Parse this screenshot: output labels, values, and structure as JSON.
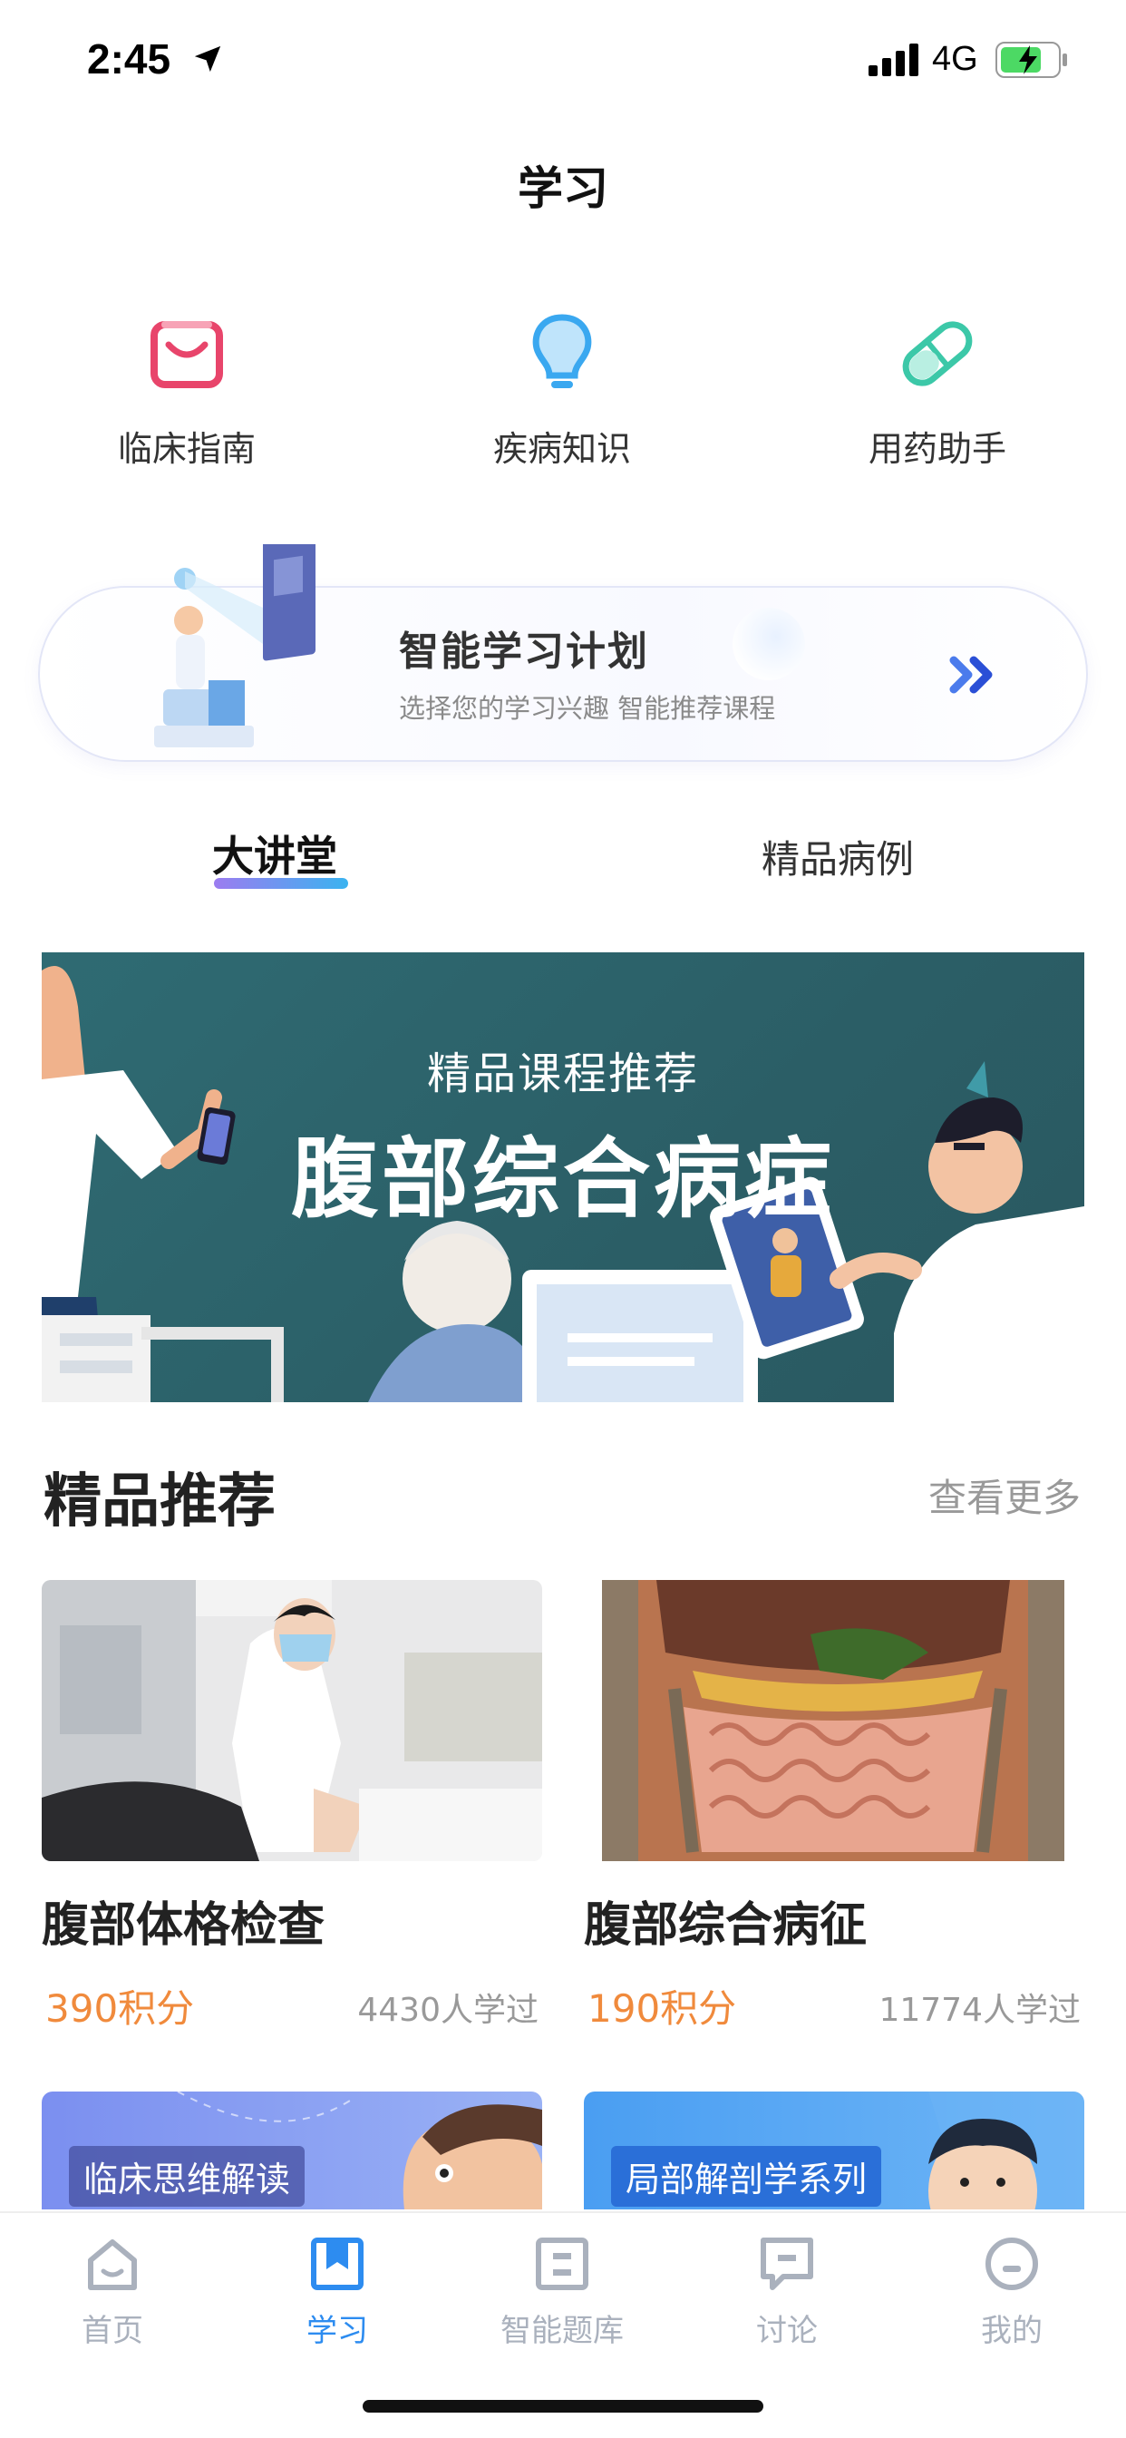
{
  "status_bar": {
    "time": "2:45",
    "network": "4G"
  },
  "header": {
    "title": "学习"
  },
  "quick_entries": [
    {
      "label": "临床指南",
      "icon": "bag-icon",
      "color": "#e8456b"
    },
    {
      "label": "疾病知识",
      "icon": "lightbulb-icon",
      "color": "#3aa8f0"
    },
    {
      "label": "用药助手",
      "icon": "pill-icon",
      "color": "#3cc8a8"
    }
  ],
  "study_plan": {
    "title": "智能学习计划",
    "subtitle": "选择您的学习兴趣 智能推荐课程"
  },
  "tabs": [
    {
      "label": "大讲堂",
      "active": true
    },
    {
      "label": "精品病例",
      "active": false
    }
  ],
  "banner": {
    "subtitle": "精品课程推荐",
    "title": "腹部综合病症"
  },
  "featured": {
    "title": "精品推荐",
    "more": "查看更多",
    "courses": [
      {
        "title": "腹部体格检查",
        "points": "390积分",
        "learners": "4430人学过"
      },
      {
        "title": "腹部综合病征",
        "points": "190积分",
        "learners": "11774人学过"
      }
    ],
    "next_row": [
      {
        "tag": "临床思维解读"
      },
      {
        "tag": "局部解剖学系列"
      }
    ]
  },
  "tabbar": [
    {
      "label": "首页",
      "icon": "home-icon",
      "active": false
    },
    {
      "label": "学习",
      "icon": "bookmark-icon",
      "active": true
    },
    {
      "label": "智能题库",
      "icon": "question-bank-icon",
      "active": false
    },
    {
      "label": "讨论",
      "icon": "chat-icon",
      "active": false
    },
    {
      "label": "我的",
      "icon": "profile-icon",
      "active": false
    }
  ],
  "colors": {
    "accent": "#2d8cf0",
    "points": "#f08a3c",
    "banner_bg": "#2f6b73",
    "tab_inactive": "#aab1bd"
  }
}
